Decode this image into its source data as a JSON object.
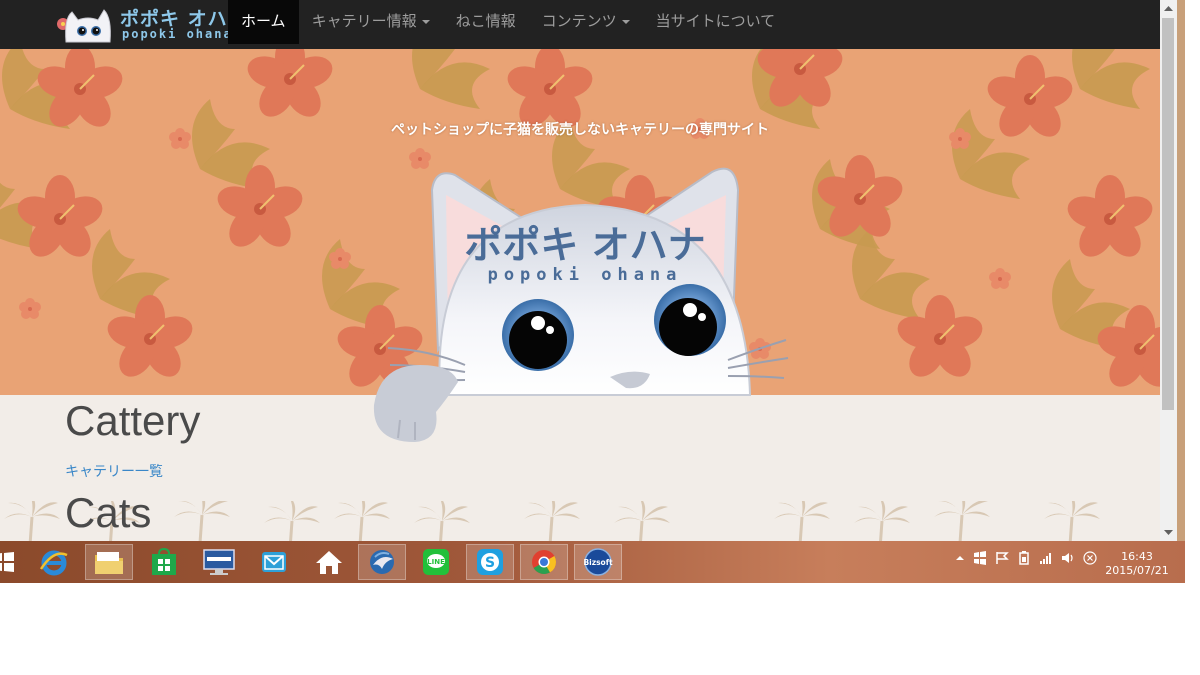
{
  "brand": {
    "title": "ポポキ オハナ",
    "subtitle": "popoki ohana"
  },
  "nav": {
    "items": [
      {
        "label": "ホーム",
        "active": true,
        "dropdown": false
      },
      {
        "label": "キャテリー情報",
        "active": false,
        "dropdown": true
      },
      {
        "label": "ねこ情報",
        "active": false,
        "dropdown": false
      },
      {
        "label": "コンテンツ",
        "active": false,
        "dropdown": true
      },
      {
        "label": "当サイトについて",
        "active": false,
        "dropdown": false
      }
    ]
  },
  "hero": {
    "tagline": "ペットショップに子猫を販売しないキャテリーの専門サイト",
    "logo_title": "ポポキ オハナ",
    "logo_subtitle": "popoki ohana"
  },
  "content": {
    "cattery_heading": "Cattery",
    "cattery_link": "キャテリー一覧",
    "cats_heading": "Cats"
  },
  "taskbar": {
    "icons": [
      "windows-start-icon",
      "internet-explorer-icon",
      "file-explorer-icon",
      "store-icon",
      "lenovo-icon",
      "mail-icon",
      "home-icon",
      "thunderbird-icon",
      "line-icon",
      "skype-icon",
      "chrome-icon",
      "bizsoft-icon"
    ],
    "bizsoft_label": "Bizsoft",
    "time": "16:43",
    "date": "2015/07/21"
  },
  "colors": {
    "navbar": "#222222",
    "hero_bg": "#e9a375",
    "hibiscus": "#e07858",
    "leaf": "#c89a50",
    "link": "#3a87c8",
    "content_bg": "#f2ede8"
  }
}
